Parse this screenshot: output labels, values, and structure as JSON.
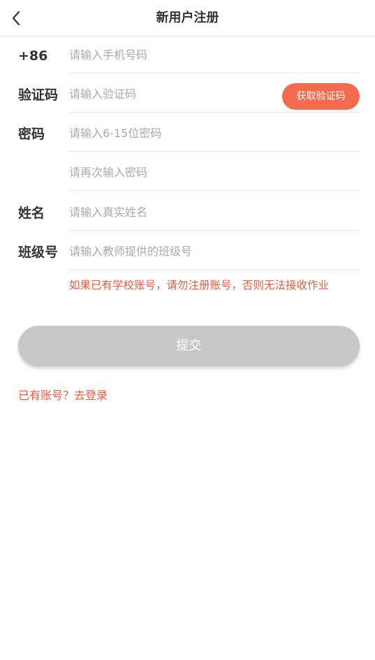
{
  "header": {
    "title": "新用户注册",
    "back_icon": "chevron-left-icon"
  },
  "form": {
    "phone": {
      "label": "+86",
      "placeholder": "请输入手机号码",
      "value": ""
    },
    "code": {
      "label": "验证码",
      "placeholder": "请输入验证码",
      "value": "",
      "button_label": "获取验证码"
    },
    "password": {
      "label": "密码",
      "placeholder": "请输入6-15位密码",
      "value": ""
    },
    "password_confirm": {
      "label": "",
      "placeholder": "请再次输入密码",
      "value": ""
    },
    "name": {
      "label": "姓名",
      "placeholder": "请输入真实姓名",
      "value": ""
    },
    "class_code": {
      "label": "班级号",
      "placeholder": "请输入教师提供的班级号",
      "value": ""
    },
    "warning": "如果已有学校账号，请勿注册账号，否则无法接收作业"
  },
  "submit_label": "提交",
  "login_link": "已有账号？去登录",
  "colors": {
    "accent": "#f26b4c",
    "warning_text": "#ec5b3d",
    "disabled_button": "#c8c8c8"
  }
}
